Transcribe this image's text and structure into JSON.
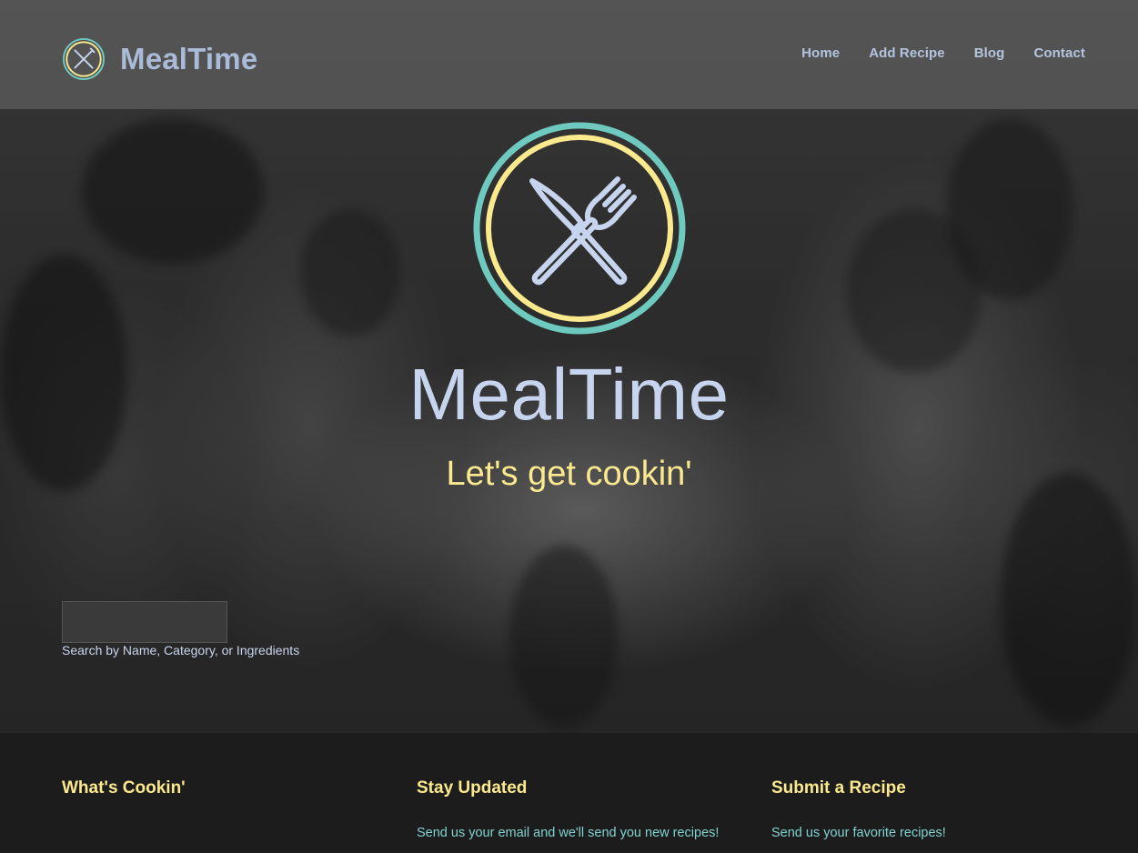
{
  "brand": {
    "name": "MealTime"
  },
  "nav": {
    "links": [
      "Home",
      "Add Recipe",
      "Blog",
      "Contact"
    ]
  },
  "hero": {
    "title": "MealTime",
    "tagline": "Let's get cookin'"
  },
  "search": {
    "value": "",
    "placeholder": "",
    "label": "Search by Name, Category, or Ingredients"
  },
  "footer": {
    "columns": [
      {
        "title": "What's Cookin'",
        "text": ""
      },
      {
        "title": "Stay Updated",
        "text": "Send us your email and we'll send you new recipes!"
      },
      {
        "title": "Submit a Recipe",
        "text": "Send us your favorite recipes!"
      }
    ]
  },
  "colors": {
    "logo_outer_ring": "#6ec9be",
    "logo_inner_ring": "#fbe98e",
    "utensils": "#c6d4ee",
    "title": "#c6d4ee",
    "tagline": "#fbe98e",
    "footer_heading": "#fbe98e",
    "footer_text": "#7fd3cf"
  },
  "icons": {
    "logo": "crossed-knife-fork-icon"
  }
}
